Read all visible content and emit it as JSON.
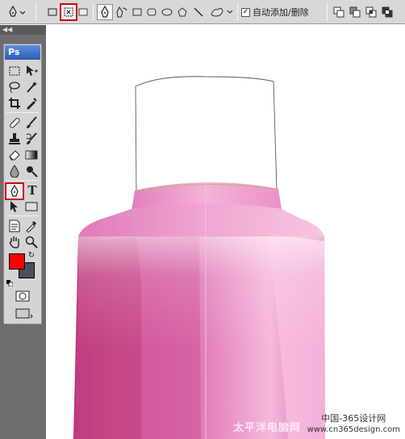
{
  "options_bar": {
    "auto_add_delete_label": "自动添加/删除",
    "auto_add_delete_checked": true
  },
  "toolbox": {
    "logo": "Ps",
    "type_tool_glyph": "T",
    "foreground_color": "#ff0000",
    "background_color": "#4a4f5c",
    "selected_tool": "pen-tool",
    "highlight_color": "#d40000"
  },
  "canvas": {
    "watermark": "太平洋电脑网",
    "site_line1": "中国-365设计网",
    "site_line2": "www.cn365design.com"
  }
}
